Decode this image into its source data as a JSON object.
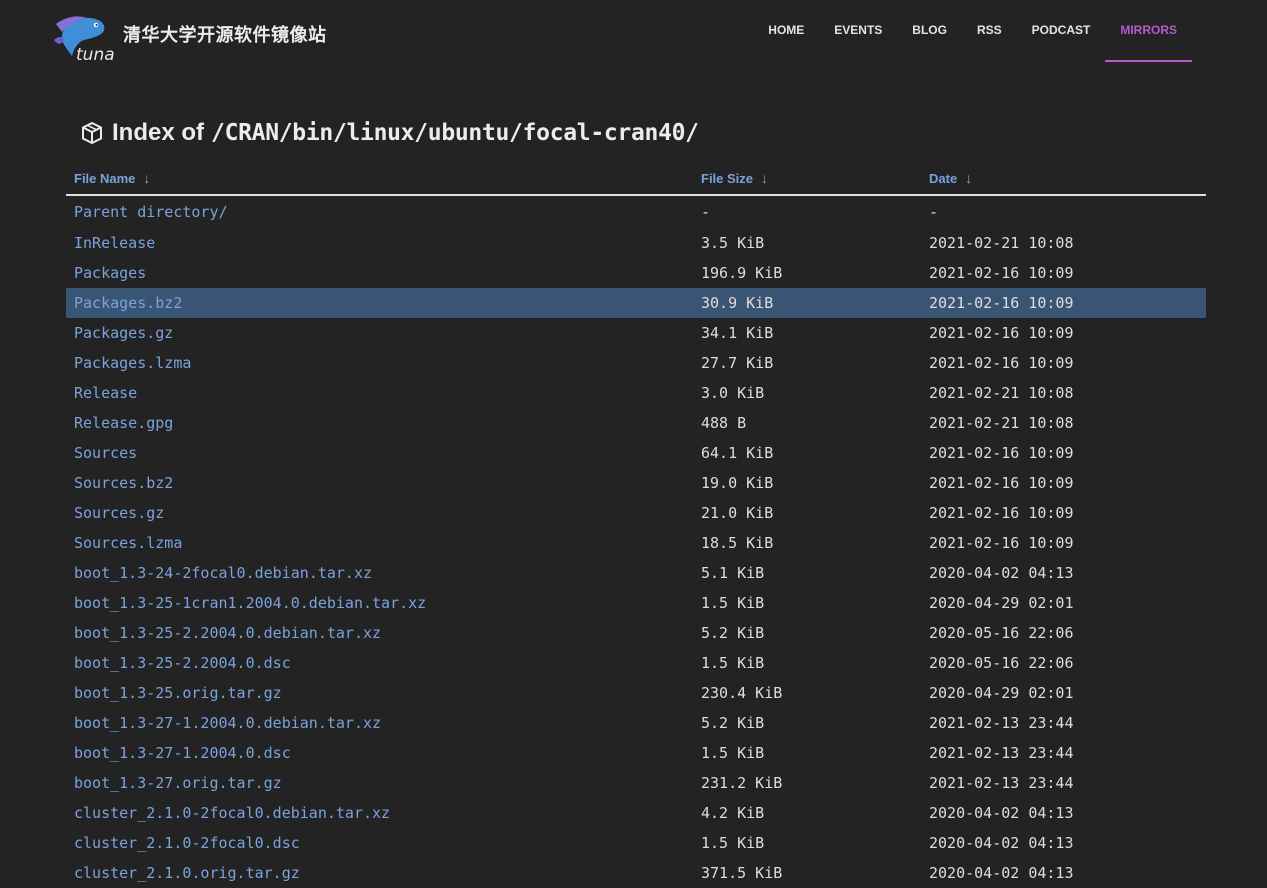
{
  "header": {
    "site_title": "清华大学开源软件镜像站",
    "logo_text": "tuna",
    "nav": [
      {
        "label": "HOME"
      },
      {
        "label": "EVENTS"
      },
      {
        "label": "BLOG"
      },
      {
        "label": "RSS"
      },
      {
        "label": "PODCAST"
      },
      {
        "label": "MIRRORS",
        "active": true
      }
    ]
  },
  "page": {
    "title_prefix": "Index of",
    "title_path": "/CRAN/bin/linux/ubuntu/focal-cran40/",
    "icon": "package-box-icon"
  },
  "table": {
    "headers": {
      "name": "File Name",
      "size": "File Size",
      "date": "Date",
      "sort_arrow": "↓"
    },
    "rows": [
      {
        "name": "Parent directory/",
        "size": "-",
        "date": "-"
      },
      {
        "name": "InRelease",
        "size": "3.5 KiB",
        "date": "2021-02-21 10:08"
      },
      {
        "name": "Packages",
        "size": "196.9 KiB",
        "date": "2021-02-16 10:09"
      },
      {
        "name": "Packages.bz2",
        "size": "30.9 KiB",
        "date": "2021-02-16 10:09",
        "highlight": true
      },
      {
        "name": "Packages.gz",
        "size": "34.1 KiB",
        "date": "2021-02-16 10:09"
      },
      {
        "name": "Packages.lzma",
        "size": "27.7 KiB",
        "date": "2021-02-16 10:09"
      },
      {
        "name": "Release",
        "size": "3.0 KiB",
        "date": "2021-02-21 10:08"
      },
      {
        "name": "Release.gpg",
        "size": "488 B",
        "date": "2021-02-21 10:08"
      },
      {
        "name": "Sources",
        "size": "64.1 KiB",
        "date": "2021-02-16 10:09"
      },
      {
        "name": "Sources.bz2",
        "size": "19.0 KiB",
        "date": "2021-02-16 10:09"
      },
      {
        "name": "Sources.gz",
        "size": "21.0 KiB",
        "date": "2021-02-16 10:09"
      },
      {
        "name": "Sources.lzma",
        "size": "18.5 KiB",
        "date": "2021-02-16 10:09"
      },
      {
        "name": "boot_1.3-24-2focal0.debian.tar.xz",
        "size": "5.1 KiB",
        "date": "2020-04-02 04:13"
      },
      {
        "name": "boot_1.3-25-1cran1.2004.0.debian.tar.xz",
        "size": "1.5 KiB",
        "date": "2020-04-29 02:01"
      },
      {
        "name": "boot_1.3-25-2.2004.0.debian.tar.xz",
        "size": "5.2 KiB",
        "date": "2020-05-16 22:06"
      },
      {
        "name": "boot_1.3-25-2.2004.0.dsc",
        "size": "1.5 KiB",
        "date": "2020-05-16 22:06"
      },
      {
        "name": "boot_1.3-25.orig.tar.gz",
        "size": "230.4 KiB",
        "date": "2020-04-29 02:01"
      },
      {
        "name": "boot_1.3-27-1.2004.0.debian.tar.xz",
        "size": "5.2 KiB",
        "date": "2021-02-13 23:44"
      },
      {
        "name": "boot_1.3-27-1.2004.0.dsc",
        "size": "1.5 KiB",
        "date": "2021-02-13 23:44"
      },
      {
        "name": "boot_1.3-27.orig.tar.gz",
        "size": "231.2 KiB",
        "date": "2021-02-13 23:44"
      },
      {
        "name": "cluster_2.1.0-2focal0.debian.tar.xz",
        "size": "4.2 KiB",
        "date": "2020-04-02 04:13"
      },
      {
        "name": "cluster_2.1.0-2focal0.dsc",
        "size": "1.5 KiB",
        "date": "2020-04-02 04:13"
      },
      {
        "name": "cluster_2.1.0.orig.tar.gz",
        "size": "371.5 KiB",
        "date": "2020-04-02 04:13"
      }
    ]
  },
  "colors": {
    "background": "#232323",
    "accent": "#b25bd0",
    "link": "#7aa3dd",
    "highlight_row": "#3a5473"
  }
}
